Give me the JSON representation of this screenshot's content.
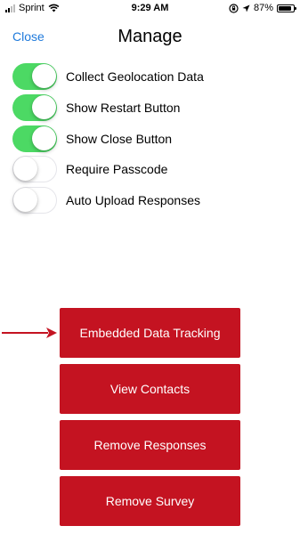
{
  "status_bar": {
    "carrier": "Sprint",
    "time": "9:29 AM",
    "battery_percent": "87%",
    "battery_level": 0.87
  },
  "nav": {
    "close_label": "Close",
    "title": "Manage"
  },
  "toggles": [
    {
      "label": "Collect Geolocation Data",
      "on": true
    },
    {
      "label": "Show Restart Button",
      "on": true
    },
    {
      "label": "Show Close Button",
      "on": true
    },
    {
      "label": "Require Passcode",
      "on": false
    },
    {
      "label": "Auto Upload Responses",
      "on": false
    }
  ],
  "buttons": [
    {
      "label": "Embedded Data Tracking"
    },
    {
      "label": "View Contacts"
    },
    {
      "label": "Remove Responses"
    },
    {
      "label": "Remove Survey"
    }
  ],
  "colors": {
    "toggle_on": "#4cd964",
    "button_bg": "#c41321",
    "link": "#1f7adb",
    "arrow": "#c41321"
  }
}
